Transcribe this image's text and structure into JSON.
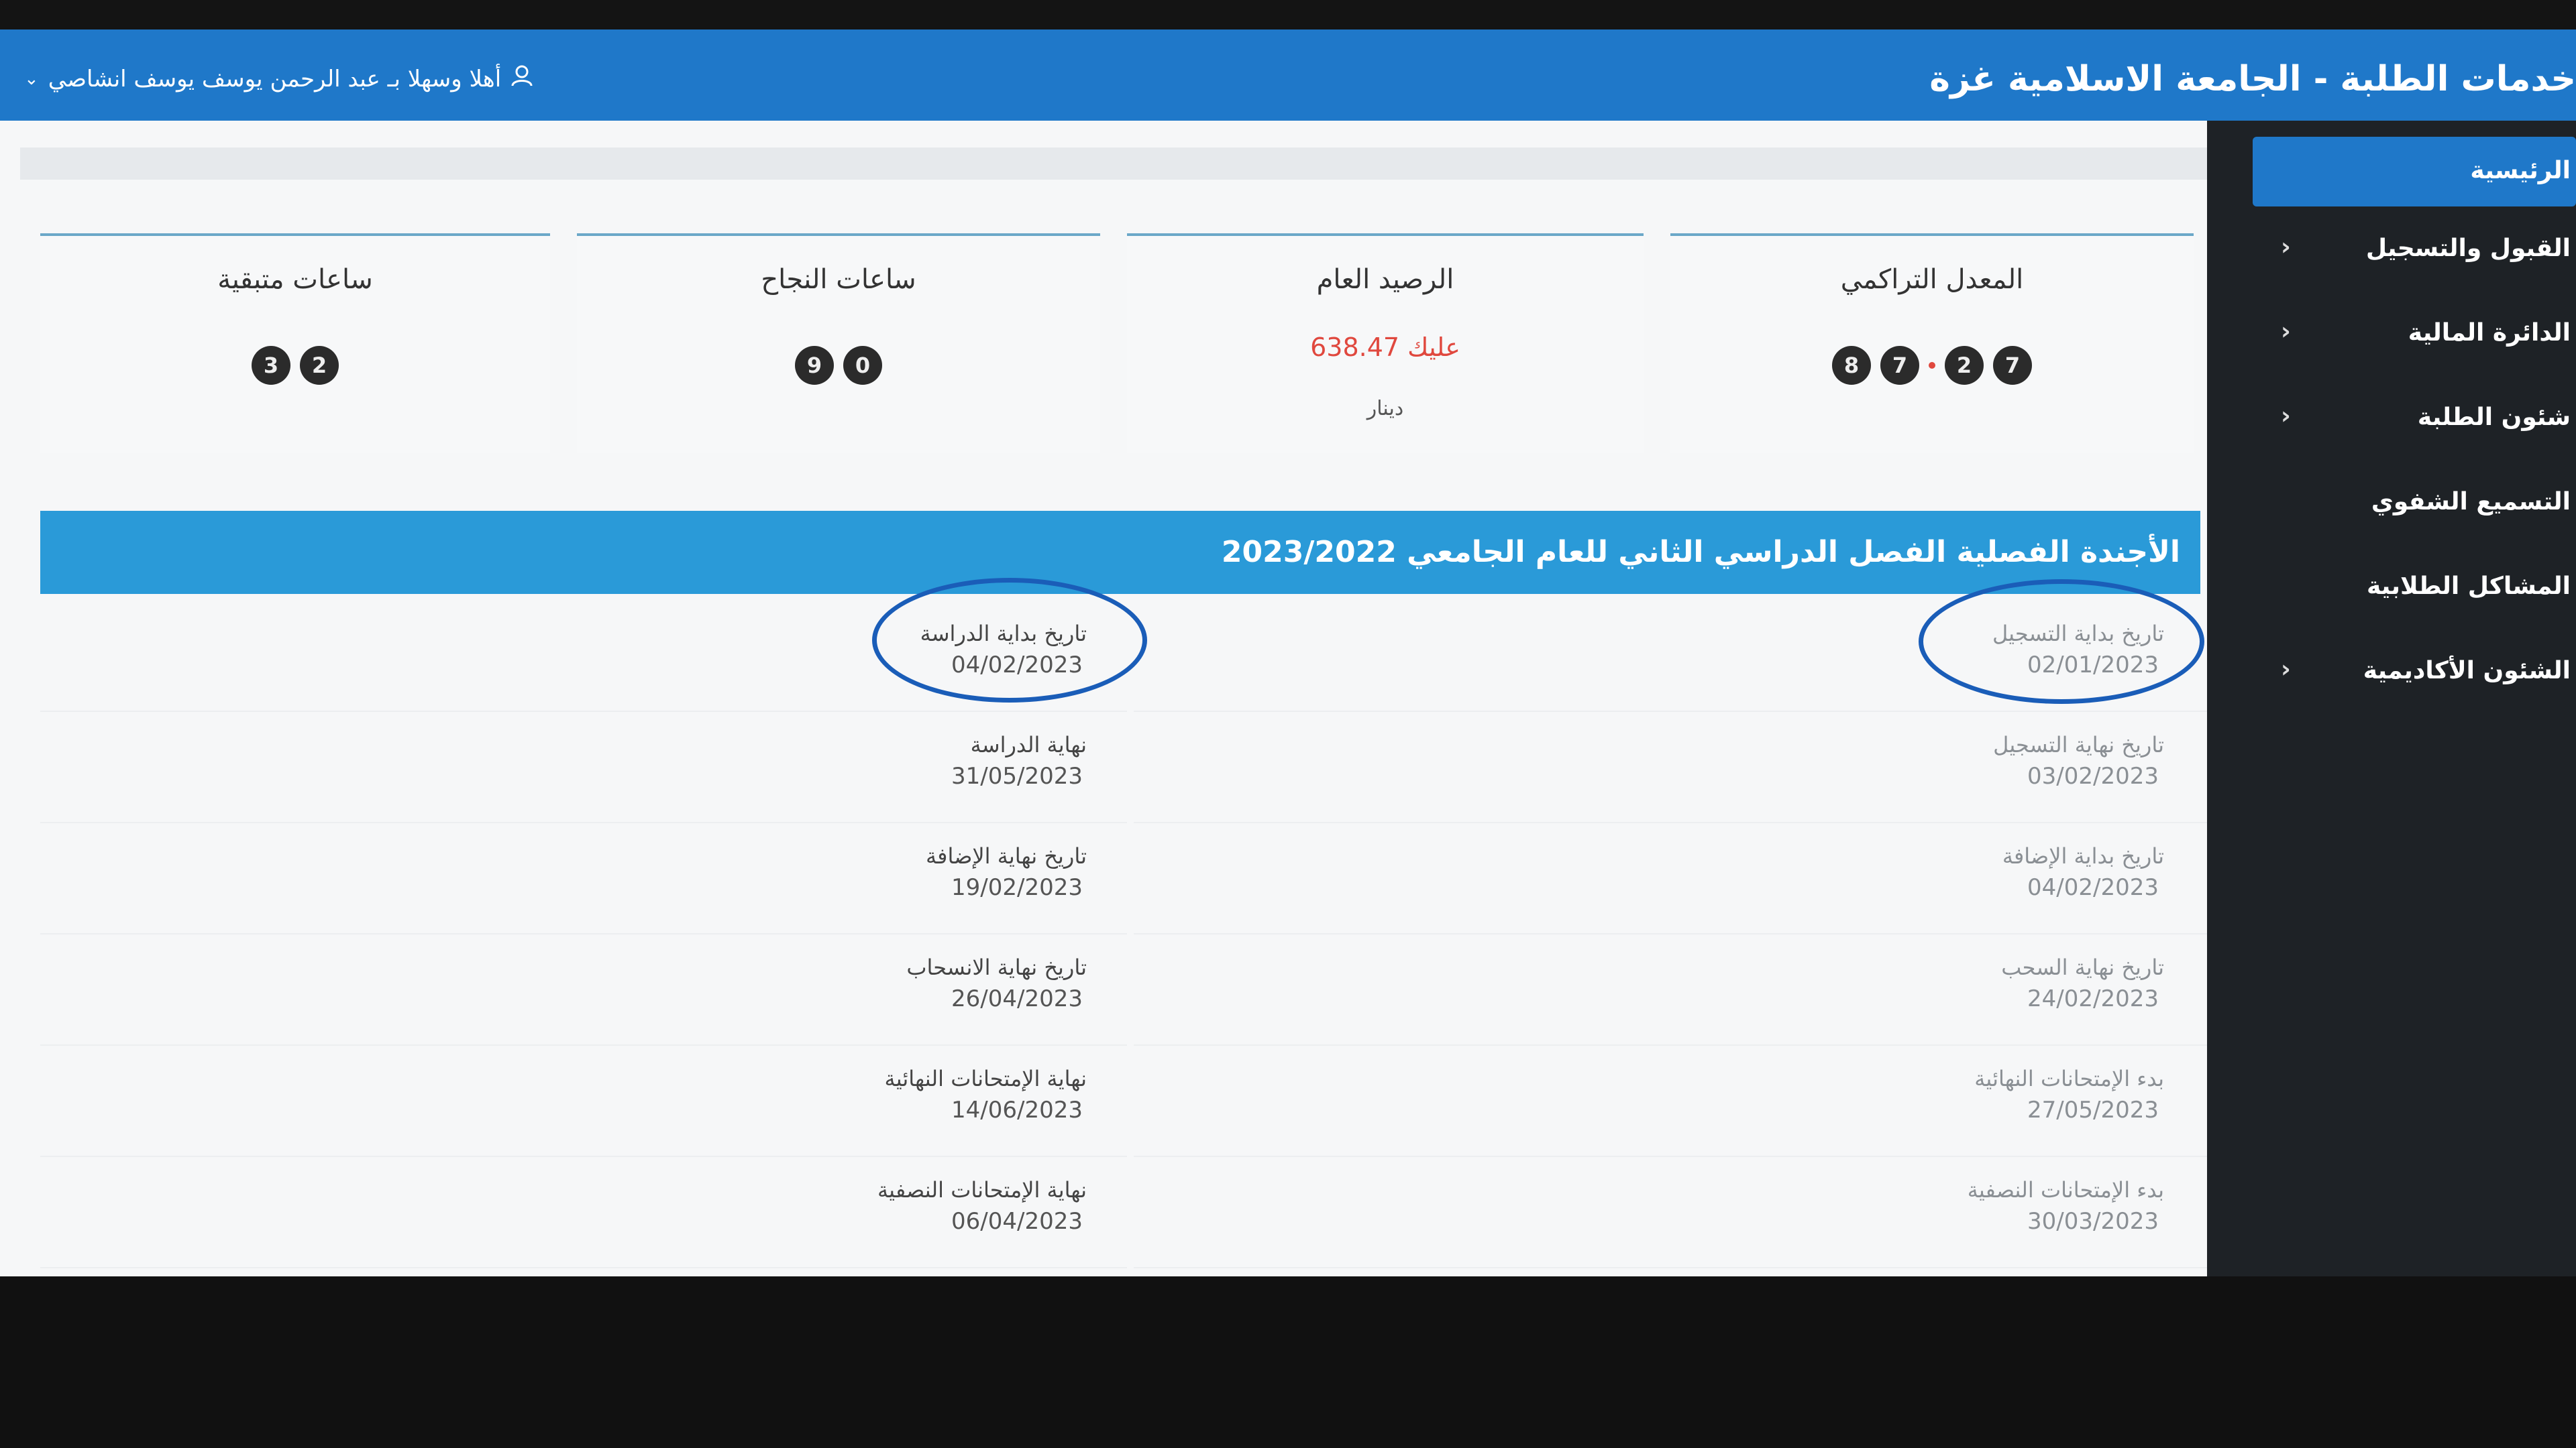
{
  "header": {
    "brand": "خدمات الطلبة - الجامعة الاسلامية غزة",
    "welcome": "أهلا وسهلا بـ عبد الرحمن يوسف يوسف انشاصي"
  },
  "sidebar": {
    "items": [
      {
        "label": "الرئيسية",
        "has_arrow": false
      },
      {
        "label": "القبول والتسجيل",
        "has_arrow": true
      },
      {
        "label": "الدائرة المالية",
        "has_arrow": true
      },
      {
        "label": "شئون الطلبة",
        "has_arrow": true
      },
      {
        "label": "التسميع الشفوي",
        "has_arrow": false
      },
      {
        "label": "المشاكل الطلابية",
        "has_arrow": false
      },
      {
        "label": "الشئون الأكاديمية",
        "has_arrow": true
      }
    ]
  },
  "cards": {
    "gpa": {
      "title": "المعدل التراكمي",
      "digits": [
        "8",
        "7",
        "2",
        "7"
      ]
    },
    "balance": {
      "title": "الرصيد العام",
      "value": "عليك 638.47",
      "currency": "دينار"
    },
    "passed": {
      "title": "ساعات النجاح",
      "digits": [
        "0",
        "9"
      ]
    },
    "remaining": {
      "title": "ساعات متبقية",
      "digits": [
        "2",
        "3"
      ]
    }
  },
  "agenda": {
    "title": "الأجندة الفصلية الفصل الدراسي الثاني للعام الجامعي 2023/2022",
    "right": [
      {
        "label": "تاريخ بداية التسجيل",
        "value": "02/01/2023"
      },
      {
        "label": "تاريخ نهاية التسجيل",
        "value": "03/02/2023"
      },
      {
        "label": "تاريخ بداية الإضافة",
        "value": "04/02/2023"
      },
      {
        "label": "تاريخ نهاية السحب",
        "value": "24/02/2023"
      },
      {
        "label": "بدء الإمتحانات النهائية",
        "value": "27/05/2023"
      },
      {
        "label": "بدء الإمتحانات النصفية",
        "value": "30/03/2023"
      }
    ],
    "left": [
      {
        "label": "تاريخ بداية الدراسة",
        "value": "04/02/2023"
      },
      {
        "label": "نهاية الدراسة",
        "value": "31/05/2023"
      },
      {
        "label": "تاريخ نهاية الإضافة",
        "value": "19/02/2023"
      },
      {
        "label": "تاريخ نهاية الانسحاب",
        "value": "26/04/2023"
      },
      {
        "label": "نهاية الإمتحانات النهائية",
        "value": "14/06/2023"
      },
      {
        "label": "نهاية الإمتحانات النصفية",
        "value": "06/04/2023"
      }
    ]
  }
}
